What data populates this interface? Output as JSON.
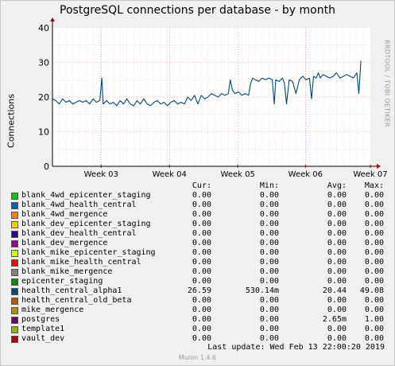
{
  "title": "PostgreSQL connections per database - by month",
  "watermark": "RRDTOOL / TOBI OETIKER",
  "legend_headers": {
    "cur": "Cur:",
    "min": "Min:",
    "avg": "Avg:",
    "max": "Max:"
  },
  "legend": [
    {
      "name": "blank_4wd_epicenter_staging",
      "color": "#00cc00",
      "cur": "0.00",
      "min": "0.00",
      "avg": "0.00",
      "max": "0.00"
    },
    {
      "name": "blank_4wd_health_central",
      "color": "#0066b3",
      "cur": "0.00",
      "min": "0.00",
      "avg": "0.00",
      "max": "0.00"
    },
    {
      "name": "blank_4wd_mergence",
      "color": "#ff8000",
      "cur": "0.00",
      "min": "0.00",
      "avg": "0.00",
      "max": "0.00"
    },
    {
      "name": "blank_dev_epicenter_staging",
      "color": "#ffcc00",
      "cur": "0.00",
      "min": "0.00",
      "avg": "0.00",
      "max": "0.00"
    },
    {
      "name": "blank_dev_health_central",
      "color": "#330099",
      "cur": "0.00",
      "min": "0.00",
      "avg": "0.00",
      "max": "0.00"
    },
    {
      "name": "blank_dev_mergence",
      "color": "#990099",
      "cur": "0.00",
      "min": "0.00",
      "avg": "0.00",
      "max": "0.00"
    },
    {
      "name": "blank_mike_epicenter_staging",
      "color": "#ccff00",
      "cur": "0.00",
      "min": "0.00",
      "avg": "0.00",
      "max": "0.00"
    },
    {
      "name": "blank_mike_health_central",
      "color": "#ff0000",
      "cur": "0.00",
      "min": "0.00",
      "avg": "0.00",
      "max": "0.00"
    },
    {
      "name": "blank_mike_mergence",
      "color": "#808080",
      "cur": "0.00",
      "min": "0.00",
      "avg": "0.00",
      "max": "0.00"
    },
    {
      "name": "epicenter_staging",
      "color": "#008f00",
      "cur": "0.00",
      "min": "0.00",
      "avg": "0.00",
      "max": "0.00"
    },
    {
      "name": "health_central_alpha1",
      "color": "#00487d",
      "cur": "26.59",
      "min": "530.14m",
      "avg": "20.44",
      "max": "49.08"
    },
    {
      "name": "health_central_old_beta",
      "color": "#b35a00",
      "cur": "0.00",
      "min": "0.00",
      "avg": "0.00",
      "max": "0.00"
    },
    {
      "name": "mike_mergence",
      "color": "#b38f00",
      "cur": "0.00",
      "min": "0.00",
      "avg": "0.00",
      "max": "0.00"
    },
    {
      "name": "postgres",
      "color": "#6b006b",
      "cur": "0.00",
      "min": "0.00",
      "avg": "2.65m",
      "max": "1.00"
    },
    {
      "name": "template1",
      "color": "#8fb300",
      "cur": "0.00",
      "min": "0.00",
      "avg": "0.00",
      "max": "0.00"
    },
    {
      "name": "vault_dev",
      "color": "#b30000",
      "cur": "0.00",
      "min": "0.00",
      "avg": "0.00",
      "max": "0.00"
    }
  ],
  "last_update": "Last update:  Wed Feb 13 22:00:20 2019",
  "version": "Munin 1.4.6",
  "chart_data": {
    "type": "line",
    "title": "PostgreSQL connections per database - by month",
    "xlabel": "",
    "ylabel": "Connections",
    "ylim": [
      0,
      40
    ],
    "yticks": [
      0,
      10,
      20,
      30,
      40
    ],
    "xticks": [
      "Week 03",
      "Week 04",
      "Week 05",
      "Week 06",
      "Week 07"
    ],
    "grid": true,
    "series": [
      {
        "name": "health_central_alpha1",
        "color": "#00487d",
        "x": [
          0,
          0.5,
          1,
          1.5,
          2,
          2.5,
          3,
          3.5,
          4,
          4.5,
          5,
          5.5,
          6,
          6.5,
          7,
          7.3,
          7.5,
          8,
          8.5,
          9,
          9.5,
          10,
          10.5,
          11,
          11.5,
          12,
          12.5,
          13,
          13.5,
          14,
          14.5,
          15,
          15.5,
          16,
          16.5,
          17,
          17.5,
          18,
          18.5,
          19,
          19.5,
          20,
          20.5,
          21,
          21.5,
          22,
          22.5,
          23,
          23.5,
          24,
          24.5,
          25,
          25.5,
          26,
          26.3,
          26.6,
          27,
          27.5,
          28,
          28.5,
          29,
          29.3,
          29.6,
          30,
          30.5,
          31,
          31.5,
          32,
          32.5,
          32.8,
          33,
          33.5,
          34,
          34.3,
          34.6,
          35,
          35.5,
          36,
          36.5,
          37,
          37.5,
          38,
          38.3,
          38.6,
          39,
          39.3,
          39.6,
          40,
          40.5,
          41,
          41.5,
          42,
          42.5,
          43,
          43.5,
          44,
          44.5,
          45,
          45.3,
          45.6
        ],
        "values": [
          19.5,
          19,
          18,
          19.5,
          18.5,
          19,
          18,
          18.5,
          19,
          18.5,
          19,
          18,
          19.5,
          18.5,
          19,
          25.5,
          18,
          19,
          18,
          18.5,
          17.5,
          19,
          18,
          19.5,
          18,
          17.5,
          19,
          18,
          19.5,
          18,
          17.5,
          18.5,
          19,
          18,
          18.5,
          17.5,
          18.5,
          19,
          18,
          18.5,
          18,
          20,
          19,
          20.5,
          18,
          20.5,
          19.5,
          20,
          21,
          20.5,
          20,
          21,
          20.5,
          21,
          25,
          22,
          21,
          21.5,
          20.5,
          21,
          20.5,
          24,
          25.5,
          25,
          24.5,
          25.5,
          25,
          25.5,
          25,
          18,
          25,
          24.5,
          25.5,
          24,
          18,
          25,
          24.5,
          21,
          25,
          26,
          25,
          25.5,
          19.5,
          26,
          25.5,
          27,
          25.5,
          26.5,
          26,
          25.5,
          26,
          27,
          25.5,
          26,
          26.5,
          26,
          25.5,
          27,
          21,
          30.5
        ]
      }
    ]
  }
}
